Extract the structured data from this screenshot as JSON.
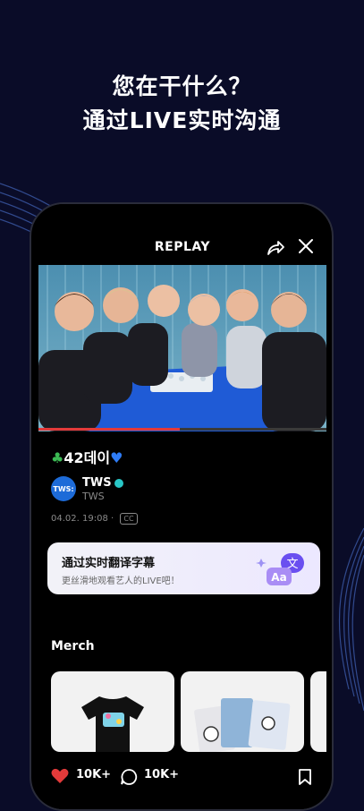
{
  "promo": {
    "line1": "您在干什么？",
    "line2": "通过LIVE实时沟通"
  },
  "header": {
    "title": "REPLAY"
  },
  "video": {
    "progress": 0.49
  },
  "post": {
    "title_text": "42데이",
    "artist_name": "TWS",
    "artist_sub": "TWS",
    "avatar_text": "TWS:",
    "datetime": "04.02. 19:08",
    "separator": "·",
    "cc": "CC"
  },
  "banner": {
    "title": "通过实时翻译字幕",
    "subtitle": "更丝滑地观看艺人的LIVE吧！",
    "icon_glyph_a": "文",
    "icon_glyph_b": "Aa"
  },
  "merch": {
    "section_title": "Merch"
  },
  "actions": {
    "likes": "10K+",
    "comments": "10K+"
  },
  "colors": {
    "background": "#0a0c28",
    "accent_red": "#e33a3a",
    "banner_bg": "#f2f2f8",
    "verified": "#28c6c6"
  }
}
